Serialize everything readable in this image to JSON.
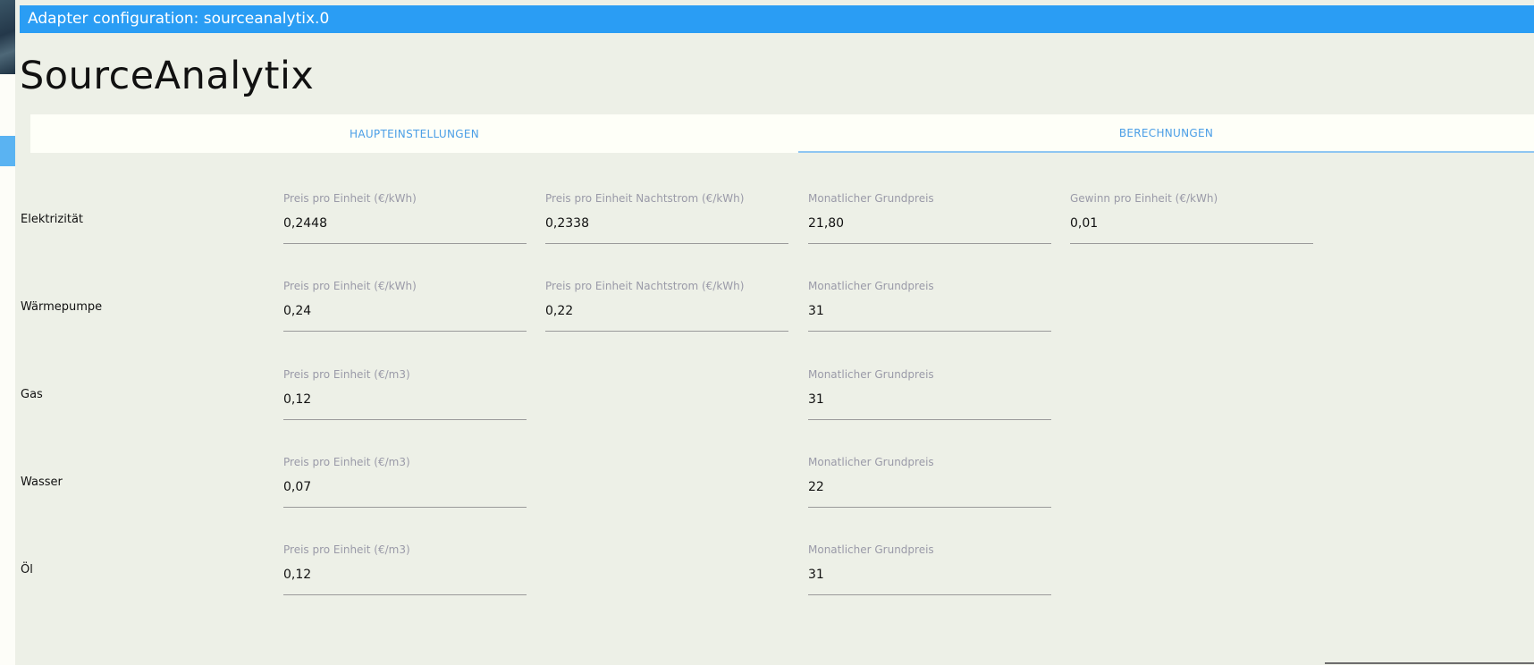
{
  "window": {
    "title": "Adapter configuration: sourceanalytix.0"
  },
  "app": {
    "heading": "SourceAnalytix"
  },
  "tabs": [
    {
      "label": "HAUPTEINSTELLUNGEN",
      "active": false
    },
    {
      "label": "BERECHNUNGEN",
      "active": true
    }
  ],
  "rows": [
    {
      "label": "Elektrizität",
      "fields": [
        {
          "label": "Preis pro Einheit (€/kWh)",
          "value": "0,2448"
        },
        {
          "label": "Preis pro Einheit Nachtstrom (€/kWh)",
          "value": "0,2338"
        },
        {
          "label": "Monatlicher Grundpreis",
          "value": "21,80"
        },
        {
          "label": "Gewinn pro Einheit (€/kWh)",
          "value": "0,01"
        }
      ]
    },
    {
      "label": "Wärmepumpe",
      "fields": [
        {
          "label": "Preis pro Einheit (€/kWh)",
          "value": "0,24"
        },
        {
          "label": "Preis pro Einheit Nachtstrom (€/kWh)",
          "value": "0,22"
        },
        {
          "label": "Monatlicher Grundpreis",
          "value": "31"
        }
      ]
    },
    {
      "label": "Gas",
      "fields": [
        {
          "label": "Preis pro Einheit (€/m3)",
          "value": "0,12"
        },
        {
          "label": "Monatlicher Grundpreis",
          "value": "31"
        }
      ]
    },
    {
      "label": "Wasser",
      "fields": [
        {
          "label": "Preis pro Einheit (€/m3)",
          "value": "0,07"
        },
        {
          "label": "Monatlicher Grundpreis",
          "value": "22"
        }
      ]
    },
    {
      "label": "Öl",
      "fields": [
        {
          "label": "Preis pro Einheit (€/m3)",
          "value": "0,12"
        },
        {
          "label": "Monatlicher Grundpreis",
          "value": "31"
        }
      ]
    }
  ]
}
